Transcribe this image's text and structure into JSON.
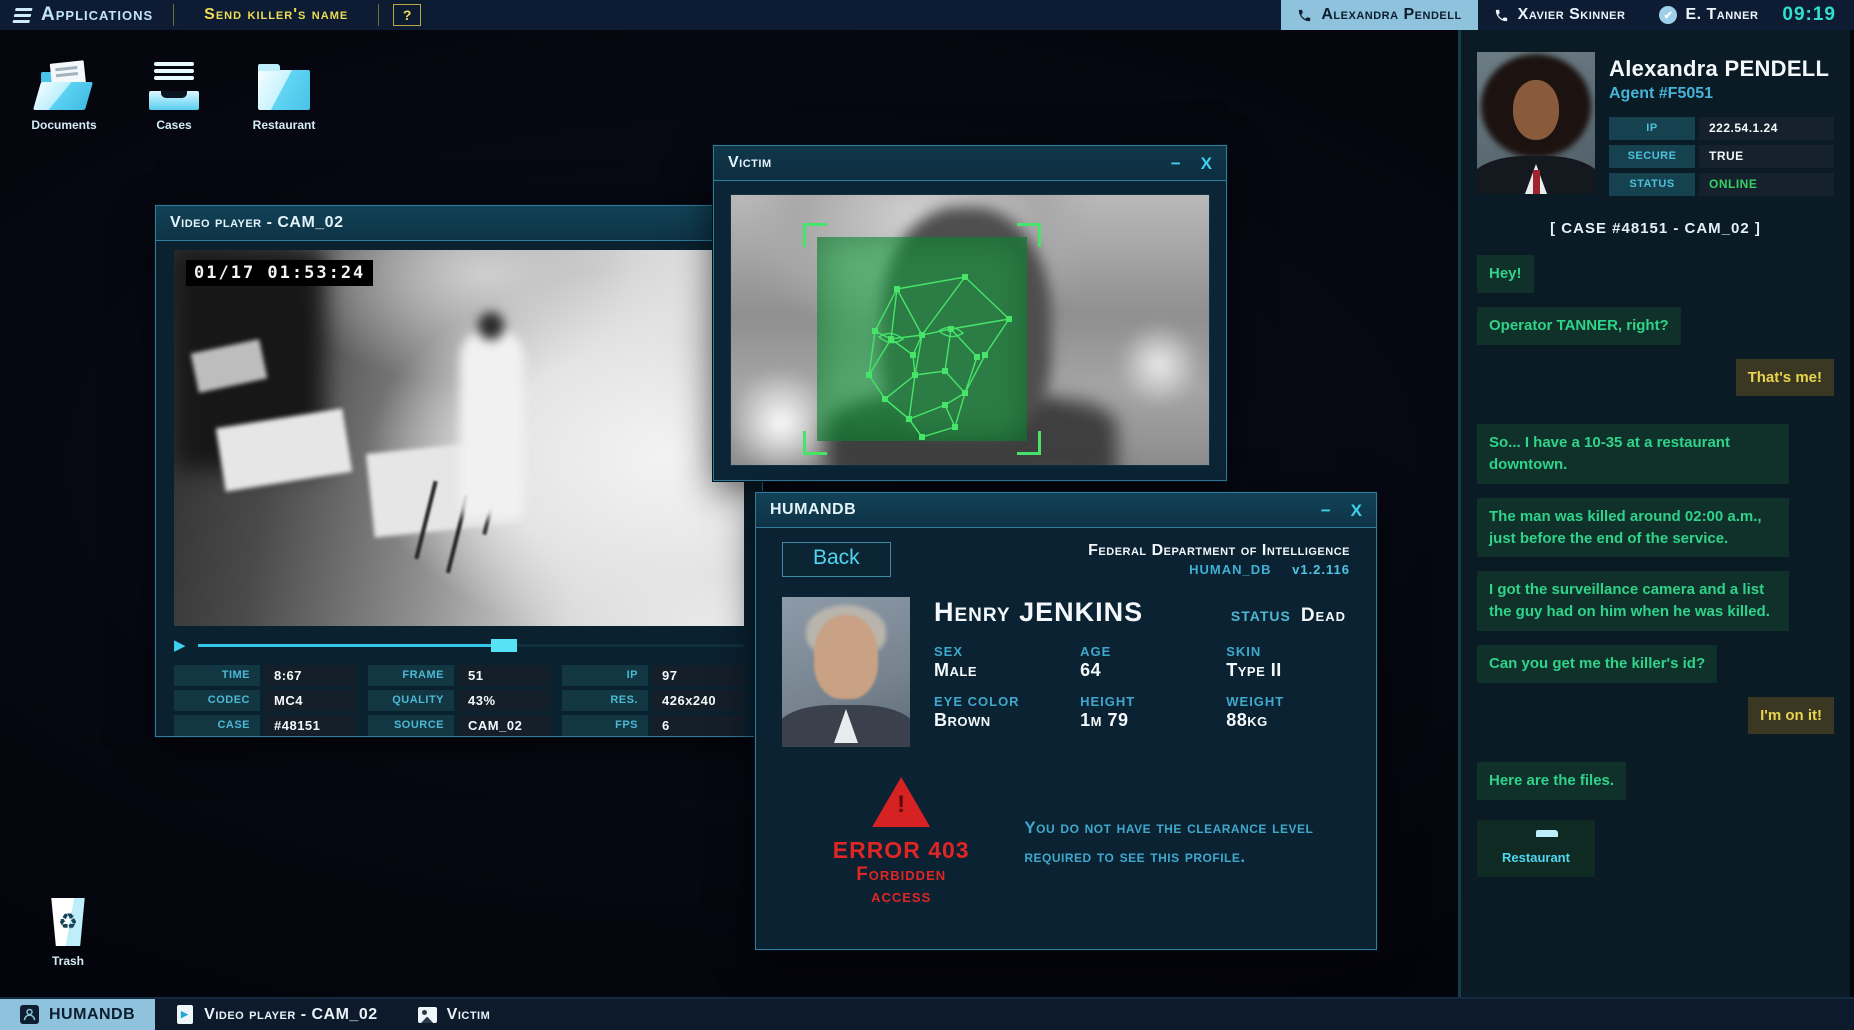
{
  "topbar": {
    "applications_label": "Applications",
    "objective_label": "Send killer's name",
    "help_label": "?",
    "calls": [
      {
        "name": "Alexandra Pendell",
        "active": true
      },
      {
        "name": "Xavier Skinner",
        "active": false
      }
    ],
    "operator_name": "E. Tanner",
    "clock": "09:19"
  },
  "desktop": {
    "icons": [
      {
        "label": "Documents"
      },
      {
        "label": "Cases"
      },
      {
        "label": "Restaurant"
      }
    ],
    "trash_label": "Trash"
  },
  "video_player": {
    "title": "Video player - CAM_02",
    "timestamp": "01/17 01:53:24",
    "progress_percent": 54,
    "stats": [
      {
        "label": "TIME",
        "value": "8:67"
      },
      {
        "label": "FRAME",
        "value": "51"
      },
      {
        "label": "IP",
        "value": "97"
      },
      {
        "label": "CODEC",
        "value": "MC4"
      },
      {
        "label": "QUALITY",
        "value": "43%"
      },
      {
        "label": "RES.",
        "value": "426x240"
      },
      {
        "label": "CASE",
        "value": "#48151"
      },
      {
        "label": "SOURCE",
        "value": "CAM_02"
      },
      {
        "label": "FPS",
        "value": "6"
      }
    ]
  },
  "victim_window": {
    "title": "Victim"
  },
  "humandb": {
    "title": "HUMANDB",
    "back_label": "Back",
    "org_title": "Federal Department of Intelligence",
    "app_name": "HUMAN_DB",
    "version": "v1.2.116",
    "person": {
      "name": "Henry JENKINS",
      "status_label": "STATUS",
      "status_value": "Dead",
      "fields": [
        {
          "label": "SEX",
          "value": "Male"
        },
        {
          "label": "AGE",
          "value": "64"
        },
        {
          "label": "SKIN",
          "value": "Type II"
        },
        {
          "label": "EYE COLOR",
          "value": "Brown"
        },
        {
          "label": "HEIGHT",
          "value": "1m 79"
        },
        {
          "label": "WEIGHT",
          "value": "88kg"
        }
      ]
    },
    "error": {
      "code": "ERROR 403",
      "name": "Forbidden access",
      "message": "You do not have the clearance level required to see this profile."
    }
  },
  "sidebar": {
    "contact": {
      "name": "Alexandra PENDELL",
      "agent_id": "Agent #F5051",
      "info": [
        {
          "label": "IP",
          "value": "222.54.1.24"
        },
        {
          "label": "SECURE",
          "value": "TRUE"
        },
        {
          "label": "STATUS",
          "value": "ONLINE"
        }
      ]
    },
    "case_header": "[   CASE #48151 - CAM_02   ]",
    "messages": [
      {
        "from": "them",
        "text": "Hey!"
      },
      {
        "from": "them",
        "text": "Operator TANNER, right?"
      },
      {
        "from": "me",
        "text": "That's me!"
      },
      {
        "from": "them",
        "text": "So... I have a 10-35 at a restaurant downtown."
      },
      {
        "from": "them",
        "text": "The man was killed around 02:00 a.m., just before the end of the service."
      },
      {
        "from": "them",
        "text": "I got the surveillance camera and a list the guy had on him when he was killed."
      },
      {
        "from": "them",
        "text": "Can you get me the killer's id?"
      },
      {
        "from": "me",
        "text": "I'm on it!"
      },
      {
        "from": "them",
        "text": "Here are the files."
      }
    ],
    "attachment_label": "Restaurant"
  },
  "taskbar": {
    "items": [
      {
        "label": "HUMANDB",
        "active": true
      },
      {
        "label": "Video player - CAM_02",
        "active": false
      },
      {
        "label": "Victim",
        "active": false
      }
    ]
  },
  "icons": {
    "minimize": "−",
    "close": "X",
    "play": "▶",
    "recycle": "♻",
    "check": "✔",
    "warning": "!"
  },
  "colors": {
    "accent_cyan": "#3fd0ef",
    "objective_yellow": "#efdc55",
    "chat_green": "#2fd389",
    "chat_yellow": "#e9d44e",
    "status_online_green": "#35d065",
    "alert_red": "#e02525",
    "scan_green": "#46e468"
  }
}
